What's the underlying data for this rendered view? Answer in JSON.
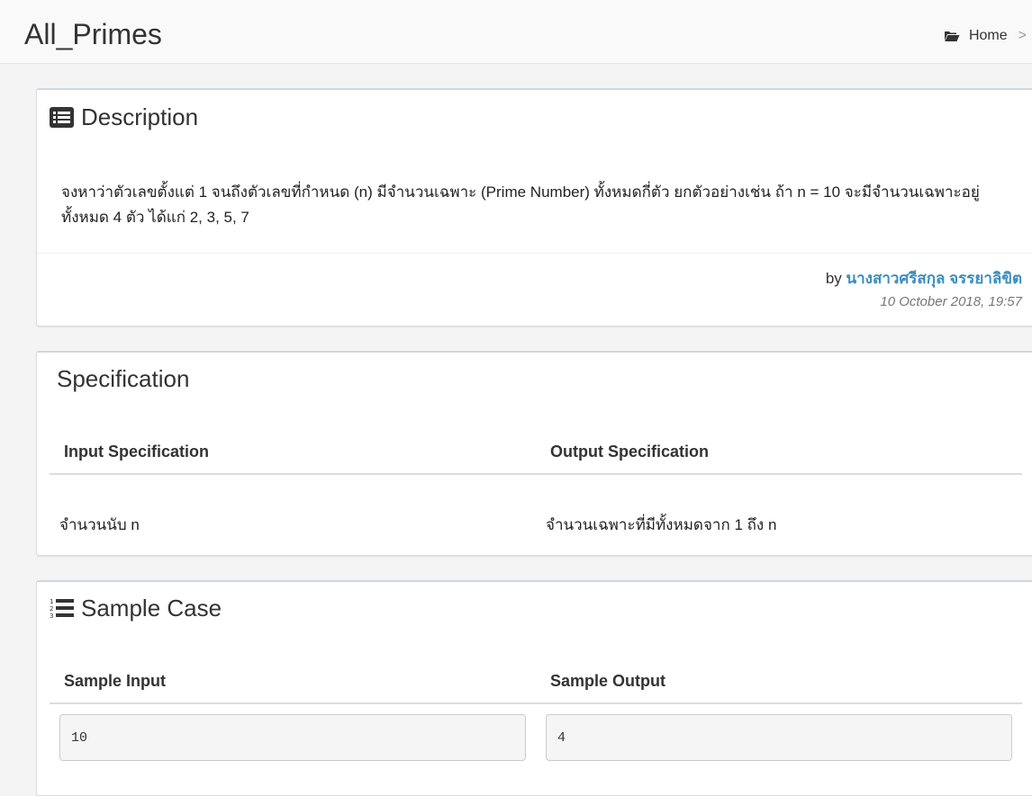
{
  "header": {
    "title": "All_Primes",
    "breadcrumb": {
      "home_label": "Home",
      "separator": ">"
    }
  },
  "description": {
    "heading": "Description",
    "heading_icon": "list-alt-icon",
    "text": "จงหาว่าตัวเลขตั้งแต่ 1 จนถึงตัวเลขที่กำหนด (n) มีจำนวนเฉพาะ (Prime Number) ทั้งหมดกี่ตัว ยกตัวอย่างเช่น ถ้า n = 10 จะมีจำนวนเฉพาะอยู่ทั้งหมด 4 ตัว ได้แก่ 2, 3, 5, 7",
    "by_label": "by",
    "author": "นางสาวศรีสกุล จรรยาลิขิต",
    "date": "10 October 2018, 19:57",
    "author_color": "#3c8dbc"
  },
  "specification": {
    "heading": "Specification",
    "input_header": "Input Specification",
    "output_header": "Output Specification",
    "input_text": "จำนวนนับ n",
    "output_text": "จำนวนเฉพาะที่มีทั้งหมดจาก 1 ถึง n"
  },
  "sample": {
    "heading": "Sample Case",
    "heading_icon": "list-ol-icon",
    "input_header": "Sample Input",
    "output_header": "Sample Output",
    "input_value": "10",
    "output_value": "4"
  }
}
